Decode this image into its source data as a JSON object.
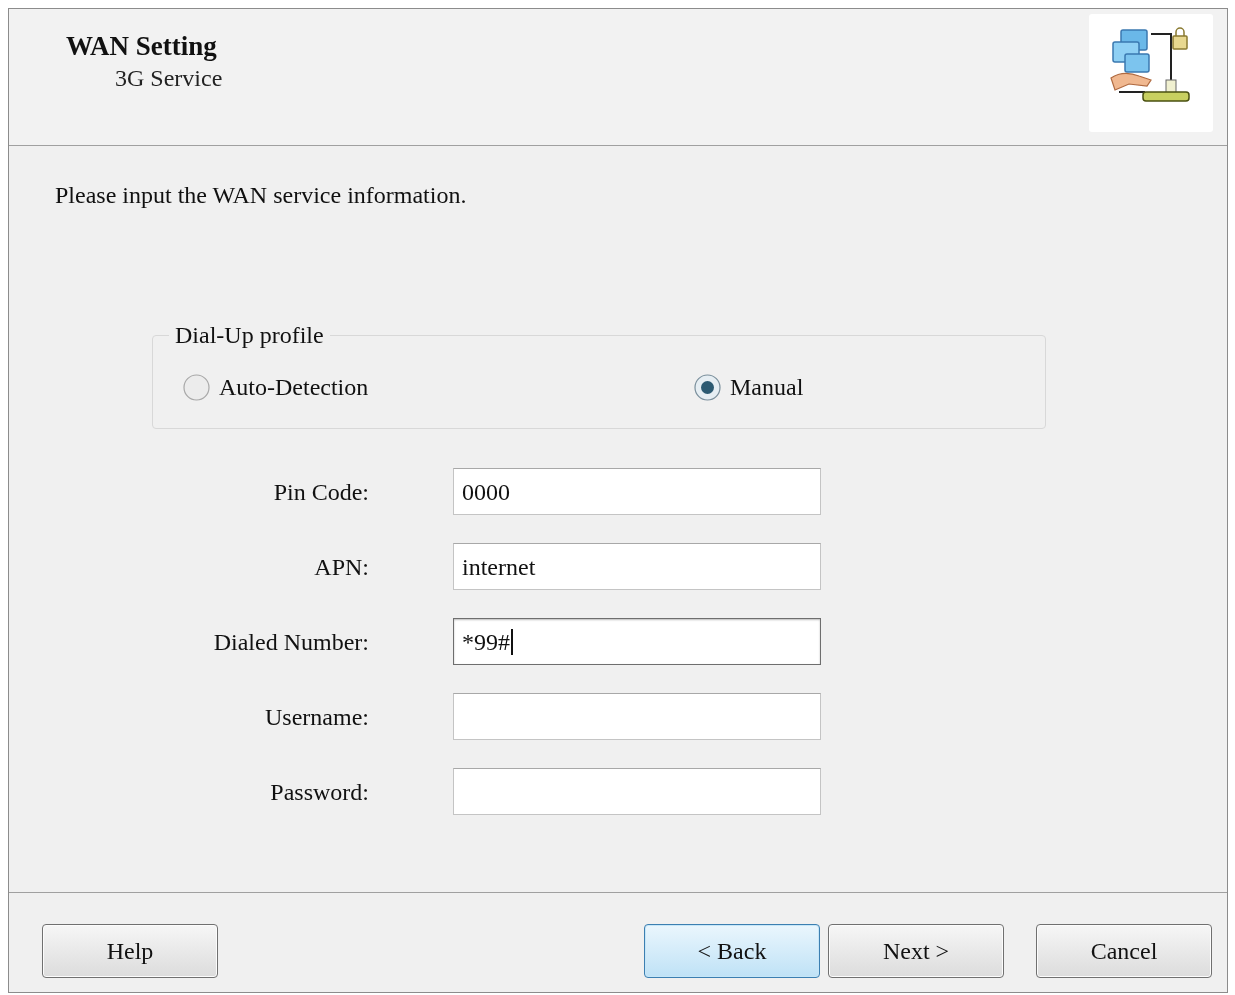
{
  "header": {
    "title": "WAN Setting",
    "subtitle": "3G Service"
  },
  "instruction": "Please input the WAN service information.",
  "profile_group": {
    "legend": "Dial-Up profile",
    "options": [
      {
        "label": "Auto-Detection",
        "selected": false
      },
      {
        "label": "Manual",
        "selected": true
      }
    ]
  },
  "fields": [
    {
      "label": "Pin Code:",
      "value": "0000",
      "focused": false
    },
    {
      "label": "APN:",
      "value": "internet",
      "focused": false
    },
    {
      "label": "Dialed Number:",
      "value": "*99#",
      "focused": true
    },
    {
      "label": "Username:",
      "focused": false
    },
    {
      "label": "Password:",
      "focused": false
    }
  ],
  "footer": {
    "left_buttons": [
      {
        "label": "Help",
        "default": false
      }
    ],
    "right_buttons": [
      {
        "label": "< Back",
        "default": true
      },
      {
        "label": "Next >",
        "default": false
      },
      {
        "label": "Cancel",
        "default": false
      }
    ]
  }
}
